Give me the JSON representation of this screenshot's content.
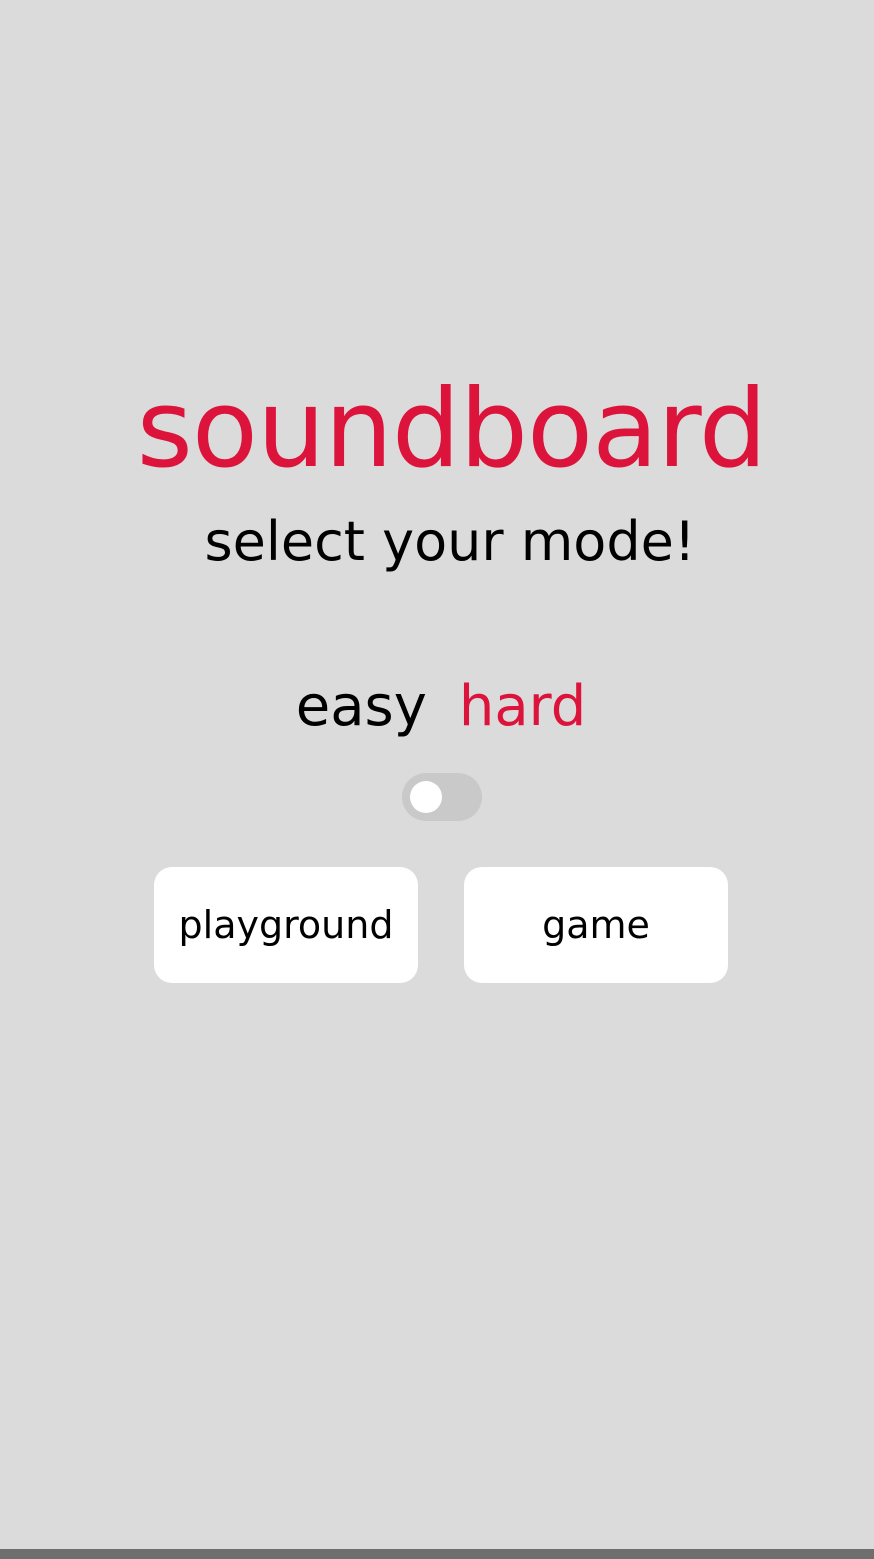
{
  "app": {
    "title": "soundboard",
    "subtitle": "select your mode!"
  },
  "mode": {
    "easy_label": "easy",
    "hard_label": "hard",
    "selected": "hard"
  },
  "buttons": {
    "playground_label": "playground",
    "game_label": "game"
  },
  "colors": {
    "accent": "#dc143c",
    "background": "#dbdbdb",
    "button_bg": "#ffffff",
    "toggle_track": "#c9c9c9"
  },
  "icons": {
    "toggle": "toggle-switch-icon"
  }
}
